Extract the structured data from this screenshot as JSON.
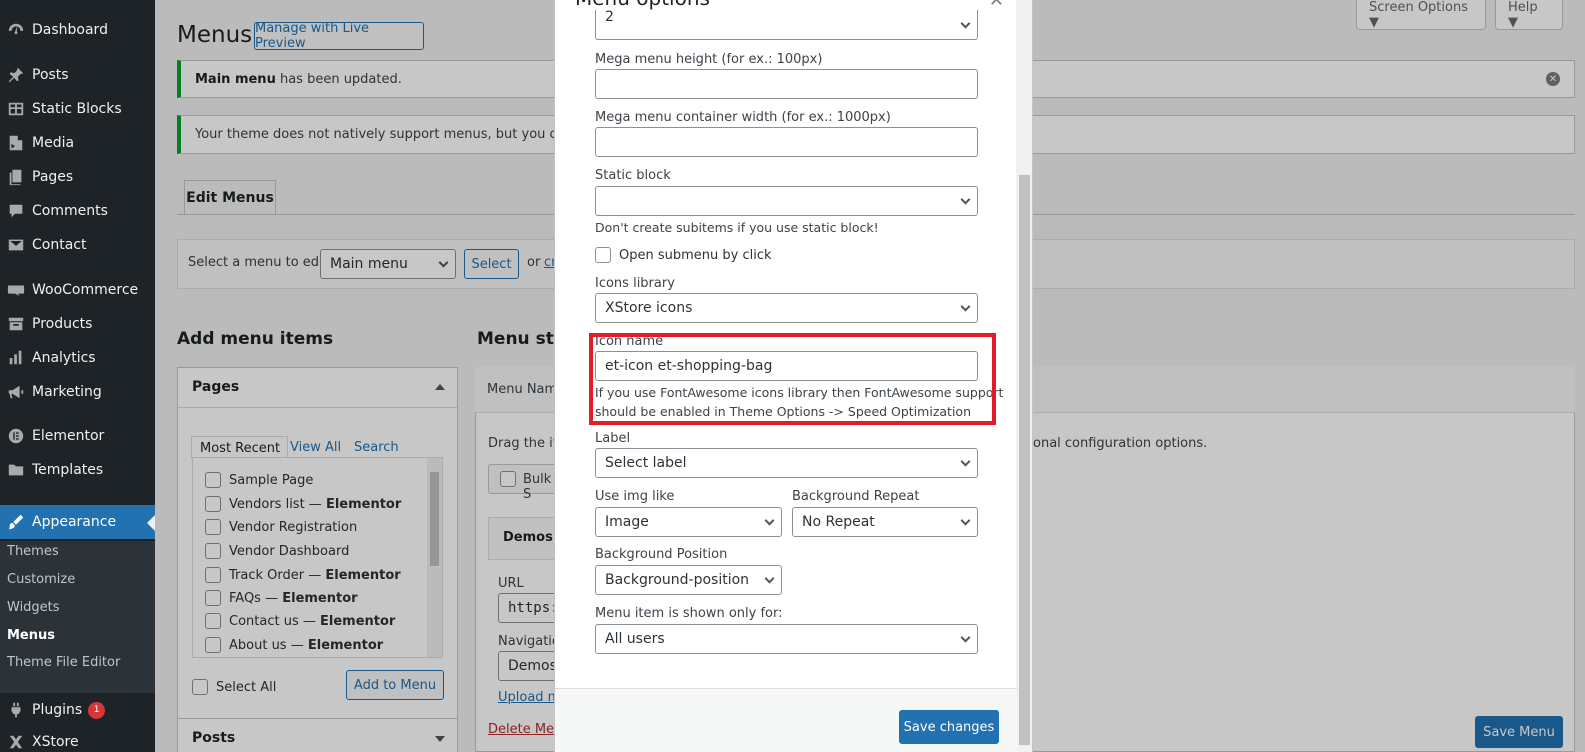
{
  "sidebar": {
    "items": [
      {
        "label": "Dashboard",
        "icon": "dashboard-icon"
      },
      {
        "label": "Posts",
        "icon": "pin-icon"
      },
      {
        "label": "Static Blocks",
        "icon": "table-icon"
      },
      {
        "label": "Media",
        "icon": "media-icon"
      },
      {
        "label": "Pages",
        "icon": "pages-icon"
      },
      {
        "label": "Comments",
        "icon": "comment-icon"
      },
      {
        "label": "Contact",
        "icon": "mail-icon"
      },
      {
        "label": "WooCommerce",
        "icon": "woo-icon"
      },
      {
        "label": "Products",
        "icon": "archive-icon"
      },
      {
        "label": "Analytics",
        "icon": "bar-chart-icon"
      },
      {
        "label": "Marketing",
        "icon": "megaphone-icon"
      },
      {
        "label": "Elementor",
        "icon": "elementor-icon"
      },
      {
        "label": "Templates",
        "icon": "folder-icon"
      },
      {
        "label": "Appearance",
        "icon": "brush-icon"
      },
      {
        "label": "Plugins",
        "icon": "plugin-icon"
      },
      {
        "label": "XStore",
        "icon": "xstore-icon"
      }
    ],
    "plugins_badge": "1",
    "submenu": [
      "Themes",
      "Customize",
      "Widgets",
      "Menus",
      "Theme File Editor"
    ]
  },
  "screen_meta": {
    "screen_options": "Screen Options ▼",
    "help": "Help ▼"
  },
  "header": {
    "title": "Menus",
    "live_preview": "Manage with Live Preview"
  },
  "notices": {
    "updated_bold": "Main menu",
    "updated_rest": " has been updated.",
    "support": "Your theme does not natively support menus, but you can use"
  },
  "tabs": {
    "edit_menus": "Edit Menus"
  },
  "manage": {
    "label": "Select a menu to edit:",
    "selected": "Main menu",
    "select_btn": "Select",
    "or_text": "or",
    "create_link": "cr"
  },
  "add_items": {
    "heading": "Add menu items",
    "pages_title": "Pages",
    "tabs": [
      "Most Recent",
      "View All",
      "Search"
    ],
    "pages": [
      {
        "name": "Sample Page",
        "suffix": ""
      },
      {
        "name": "Vendors list",
        "suffix": "Elementor"
      },
      {
        "name": "Vendor Registration",
        "suffix": ""
      },
      {
        "name": "Vendor Dashboard",
        "suffix": ""
      },
      {
        "name": "Track Order",
        "suffix": "Elementor"
      },
      {
        "name": "FAQs",
        "suffix": "Elementor"
      },
      {
        "name": "Contact us",
        "suffix": "Elementor"
      },
      {
        "name": "About us",
        "suffix": "Elementor"
      }
    ],
    "dash": " — ",
    "select_all": "Select All",
    "add_to_menu": "Add to Menu",
    "posts_title": "Posts"
  },
  "structure": {
    "heading": "Menu stru",
    "menu_name": "Menu Nam",
    "drag_text": "Drag the ite",
    "drag_text_right": "onal configuration options.",
    "bulk": "Bulk S",
    "item_title": "Demos",
    "url_label": "URL",
    "url_value": "https:",
    "nav_label": "Navigatio",
    "nav_value": "Demos",
    "upload": "Upload m",
    "delete": "Delete Men",
    "save_menu": "Save Menu"
  },
  "modal": {
    "title": "Menu options",
    "top_select": "2",
    "mega_height_label": "Mega menu height (for ex.: 100px)",
    "mega_height_value": "",
    "mega_width_label": "Mega menu container width (for ex.: 1000px)",
    "mega_width_value": "",
    "static_block_label": "Static block",
    "static_block_value": "",
    "static_block_help": "Don't create subitems if you use static block!",
    "open_submenu": "Open submenu by click",
    "icons_library_label": "Icons library",
    "icons_library_value": "XStore icons",
    "icon_name_label": "Icon name",
    "icon_name_value": "et-icon et-shopping-bag",
    "icon_help_line1": "If you use FontAwesome icons library then FontAwesome support",
    "icon_help_line2": "should be enabled in Theme Options -> Speed Optimization",
    "label_label": "Label",
    "label_value": "Select label",
    "img_like_label": "Use img like",
    "img_like_value": "Image",
    "bg_repeat_label": "Background Repeat",
    "bg_repeat_value": "No Repeat",
    "bg_position_label": "Background Position",
    "bg_position_value": "Background-position",
    "shown_for_label": "Menu item is shown only for:",
    "shown_for_value": "All users",
    "save": "Save changes"
  },
  "colors": {
    "primary": "#2271b1",
    "sidebar": "#1d2327",
    "highlight": "#e11d2a",
    "notice": "#00a32a"
  }
}
